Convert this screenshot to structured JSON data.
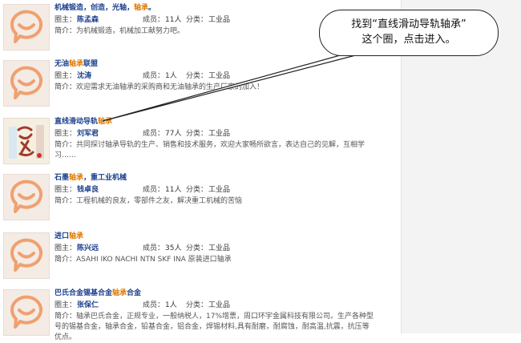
{
  "labels": {
    "owner": "圈主：",
    "members": "成员：",
    "category": "分类：",
    "intro": "简介："
  },
  "items": [
    {
      "title_parts": [
        "机械锻造，创造，光轴，",
        "轴承",
        "。"
      ],
      "owner": "陈孟森",
      "members": "11人",
      "category": "工业品",
      "intro": "为机械锻造，机械加工献努力吧。",
      "avatar_icon": "chat-bubble-icon"
    },
    {
      "title_parts": [
        "无油",
        "轴承",
        "联盟"
      ],
      "owner": "沈涛",
      "members": "1人",
      "category": "工业品",
      "intro": "欢迎需求无油轴承的采购商和无油轴承的生产厂家的加入！",
      "avatar_icon": "chat-bubble-icon"
    },
    {
      "title_parts": [
        "直线滑动导轨",
        "轴承",
        ""
      ],
      "owner": "刘军君",
      "members": "77人",
      "category": "工业品",
      "intro": "共同探讨轴承导轨的生产、销售和技术服务，欢迎大家畅所欲言，表达自己的见解，互相学习……",
      "avatar_icon": "calligraphy-image"
    },
    {
      "title_parts": [
        "石墨",
        "轴承",
        "，重工业机械"
      ],
      "owner": "钱卓良",
      "members": "11人",
      "category": "工业品",
      "intro": "工程机械的良友，零部件之友，解决重工机械的苦恼",
      "avatar_icon": "chat-bubble-icon"
    },
    {
      "title_parts": [
        "进口",
        "轴承",
        ""
      ],
      "owner": "陈兴远",
      "members": "35人",
      "category": "工业品",
      "intro": "ASAHI IKO NACHI NTN SKF INA 原装进口轴承",
      "avatar_icon": "chat-bubble-icon"
    },
    {
      "title_parts": [
        "巴氏合金锡基合金",
        "轴承",
        "合金"
      ],
      "owner": "张保仁",
      "members": "1人",
      "category": "工业品",
      "intro": "轴承巴氏合金，正规专业，一般纳税人，17%增票，周口环宇金属科技有限公司。生产各种型号的锡基合金，轴承合金，铅基合金，铝合金，焊锡材料,具有耐磨，耐腐蚀，耐高温,抗震，抗压等优点。",
      "avatar_icon": "chat-bubble-icon"
    }
  ],
  "callout": {
    "line1": "找到“直线滑动导轨轴承”",
    "line2": "这个圈，点击进入。"
  },
  "colors": {
    "title": "#1a3f8c",
    "highlight": "#e07a00",
    "avatar_orange": "#f0a070"
  }
}
